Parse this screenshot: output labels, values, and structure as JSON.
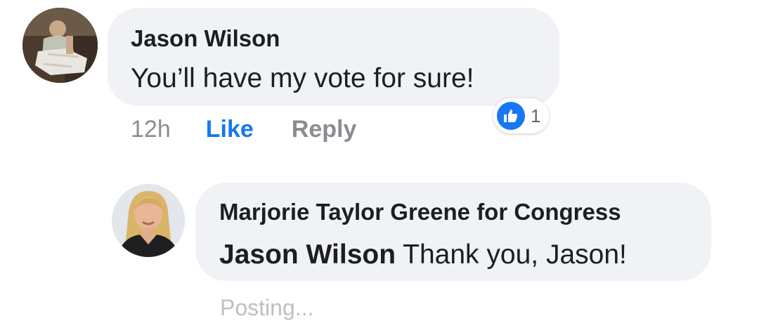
{
  "comment": {
    "author": "Jason Wilson",
    "text": "You’ll have my vote for sure!",
    "time": "12h",
    "like_label": "Like",
    "reply_label": "Reply",
    "reaction_count": "1",
    "reaction_icon": "thumbs-up-icon"
  },
  "reply": {
    "author": "Marjorie Taylor Greene for Congress",
    "mention": "Jason Wilson",
    "text": " Thank you, Jason!",
    "status": "Posting..."
  },
  "colors": {
    "bubble": "#f0f2f5",
    "accent": "#1877f2",
    "muted_text": "#8a8d91",
    "status_text": "#bcc0c4"
  }
}
